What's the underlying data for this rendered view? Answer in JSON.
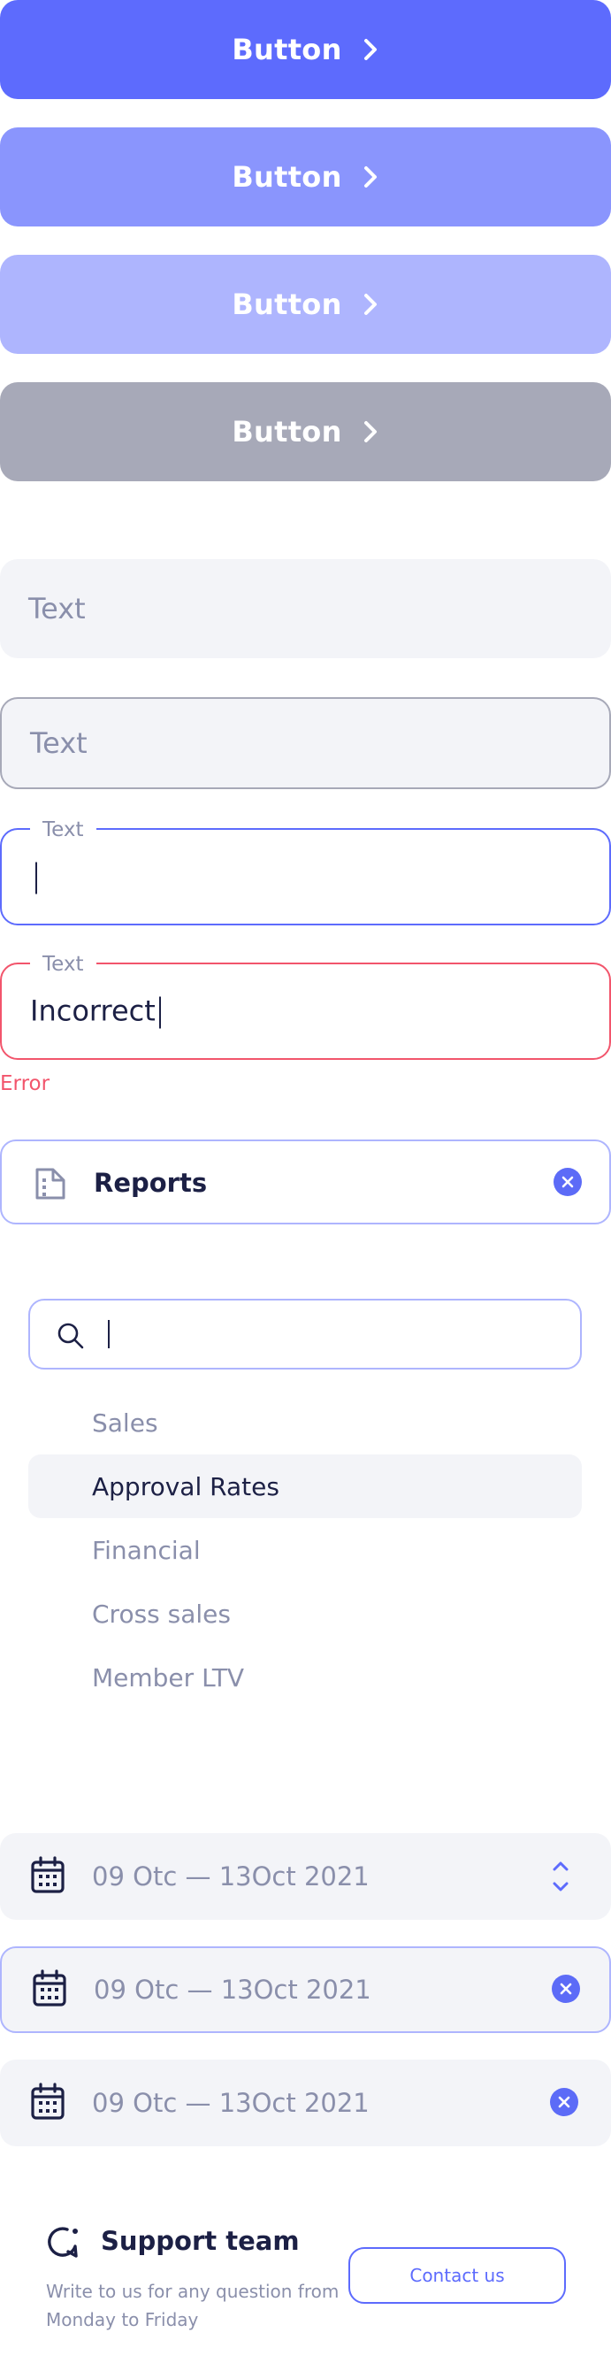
{
  "buttons": [
    {
      "label": "Button",
      "color": "#5d6bfd",
      "state": "default"
    },
    {
      "label": "Button",
      "color": "#8a95fd",
      "state": "hover"
    },
    {
      "label": "Button",
      "color": "#aeb5fe",
      "state": "light"
    },
    {
      "label": "Button",
      "color": "#a7a9b8",
      "state": "disabled"
    }
  ],
  "inputs": {
    "filled_placeholder": "Text",
    "outlined_placeholder": "Text",
    "focused_label": "Text",
    "focused_value": "",
    "error_label": "Text",
    "error_value": "Incorrect",
    "error_message": "Error"
  },
  "report_select": {
    "icon": "report-document-icon",
    "value": "Reports",
    "clear_icon": "close-icon"
  },
  "dropdown": {
    "search_value": "",
    "options": [
      "Sales",
      "Approval Rates",
      "Financial",
      "Cross sales",
      "Member LTV"
    ],
    "highlighted_index": 1
  },
  "date_fields": [
    {
      "value": "09 Otc — 13Oct 2021",
      "action_icon": "chevron-up-down-icon",
      "state": "default"
    },
    {
      "value": "09 Otc — 13Oct 2021",
      "action_icon": "close-icon",
      "state": "focused"
    },
    {
      "value": "09 Otc — 13Oct 2021",
      "action_icon": "close-icon",
      "state": "filled"
    }
  ],
  "support": {
    "title": "Support team",
    "description_line1": "Write to us for any question from",
    "description_line2": "Monday to Friday",
    "button_label": "Contact us",
    "icon": "support-chat-icon"
  },
  "colors": {
    "primary": "#5d6bfd",
    "error": "#f2556c",
    "text_dark": "#1c2045",
    "text_muted": "#8a8fab",
    "field_bg": "#f3f4f8"
  }
}
